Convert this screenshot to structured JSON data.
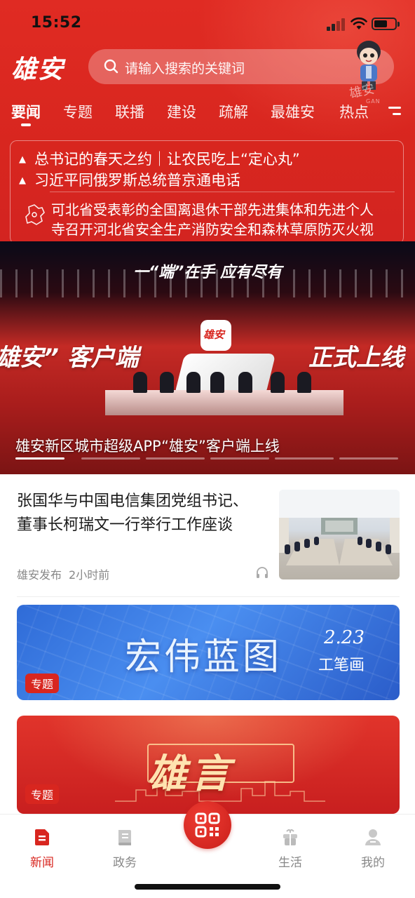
{
  "status_bar": {
    "time": "15:52"
  },
  "header": {
    "logo": "雄安",
    "search_placeholder": "请输入搜索的关键词",
    "mascot_caption": "雄安",
    "mascot_sub": "GAN"
  },
  "tabs": [
    {
      "label": "要闻",
      "active": true
    },
    {
      "label": "专题"
    },
    {
      "label": "联播"
    },
    {
      "label": "建设"
    },
    {
      "label": "疏解"
    },
    {
      "label": "最雄安"
    },
    {
      "label": "热点"
    }
  ],
  "top_news": {
    "pinned": [
      "总书记的春天之约｜让农民吃上“定心丸”",
      "习近平同俄罗斯总统普京通电话"
    ],
    "provincial": [
      "可北省受表彰的全国离退休干部先进集体和先进个人",
      "寺召开河北省安全生产消防安全和森林草原防灭火视"
    ]
  },
  "hero": {
    "slogan": "一“端”在手 应有尽有",
    "big_left": "雄安” 客户端",
    "big_right": "正式上线",
    "app_icon_text": "雄安",
    "caption": "雄安新区城市超级APP“雄安”客户端上线",
    "slides": 6,
    "active_slide": 0
  },
  "article": {
    "title": "张国华与中国电信集团党组书记、董事长柯瑞文一行举行工作座谈",
    "source": "雄安发布",
    "time": "2小时前"
  },
  "topics": [
    {
      "title": "宏伟蓝图",
      "date": "2.23",
      "subtitle": "工笔画",
      "tag": "专题"
    },
    {
      "title": "雄言",
      "tag": "专题"
    }
  ],
  "bottom_nav": [
    {
      "label": "新闻",
      "icon": "news-icon",
      "active": true
    },
    {
      "label": "政务",
      "icon": "government-icon"
    },
    {
      "label": "生活",
      "icon": "life-icon"
    },
    {
      "label": "我的",
      "icon": "profile-icon"
    }
  ],
  "colors": {
    "brand_red": "#d8261f",
    "text_gray": "#888888"
  }
}
